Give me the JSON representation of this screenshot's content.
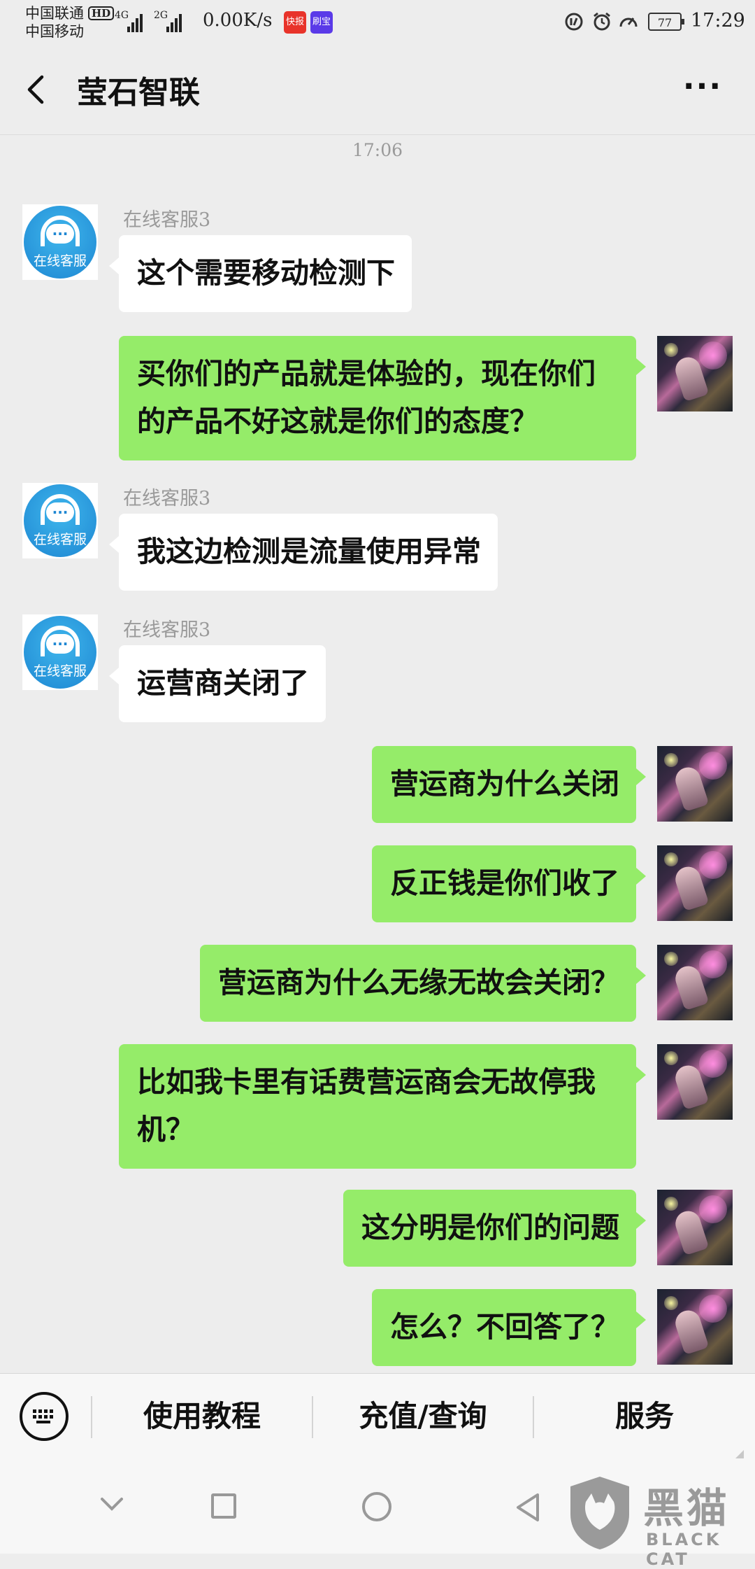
{
  "status_bar": {
    "carrier_1": "中国联通",
    "hd": "HD",
    "carrier_2": "中国移动",
    "signal_1_label": "4G",
    "signal_2_label": "2G",
    "net_speed": "0.00K/s",
    "app_badge_1": "快报",
    "app_badge_2": "刷宝",
    "battery": "77",
    "time": "17:29",
    "icons": [
      "data-saver-icon",
      "alarm-icon",
      "speedometer-icon"
    ]
  },
  "header": {
    "title": "莹石智联",
    "back_icon": "chevron-left-icon",
    "more_icon": "more-dots-icon",
    "more_label": "···"
  },
  "chat": {
    "timestamp": "17:06",
    "agent_avatar_label": "在线客服",
    "agent_avatar_dots": "···",
    "messages": [
      {
        "from": "agent",
        "sender": "在线客服3",
        "text": "这个需要移动检测下"
      },
      {
        "from": "me",
        "text": "买你们的产品就是体验的，现在你们的产品不好这就是你们的态度？"
      },
      {
        "from": "agent",
        "sender": "在线客服3",
        "text": "我这边检测是流量使用异常"
      },
      {
        "from": "agent",
        "sender": "在线客服3",
        "text": "运营商关闭了"
      },
      {
        "from": "me",
        "text": "营运商为什么关闭"
      },
      {
        "from": "me",
        "text": "反正钱是你们收了"
      },
      {
        "from": "me",
        "text": "营运商为什么无缘无故会关闭？"
      },
      {
        "from": "me",
        "text": "比如我卡里有话费营运商会无故停我机？"
      },
      {
        "from": "me",
        "text": "这分明是你们的问题"
      },
      {
        "from": "me",
        "text": "怎么？不回答了？"
      }
    ]
  },
  "bottom_menu": {
    "keyboard_icon": "keyboard-icon",
    "keyboard_keys": "▪▪▪▪\n▪▪▪▪\n ▬▬",
    "items": [
      "使用教程",
      "充值/查询",
      "服务"
    ]
  },
  "watermark": {
    "brand": "黑猫",
    "sub": "BLACK CAT"
  },
  "colors": {
    "background": "#ededed",
    "incoming_bubble": "#ffffff",
    "outgoing_bubble": "#95ec69",
    "agent_avatar": "#1d86d2"
  }
}
